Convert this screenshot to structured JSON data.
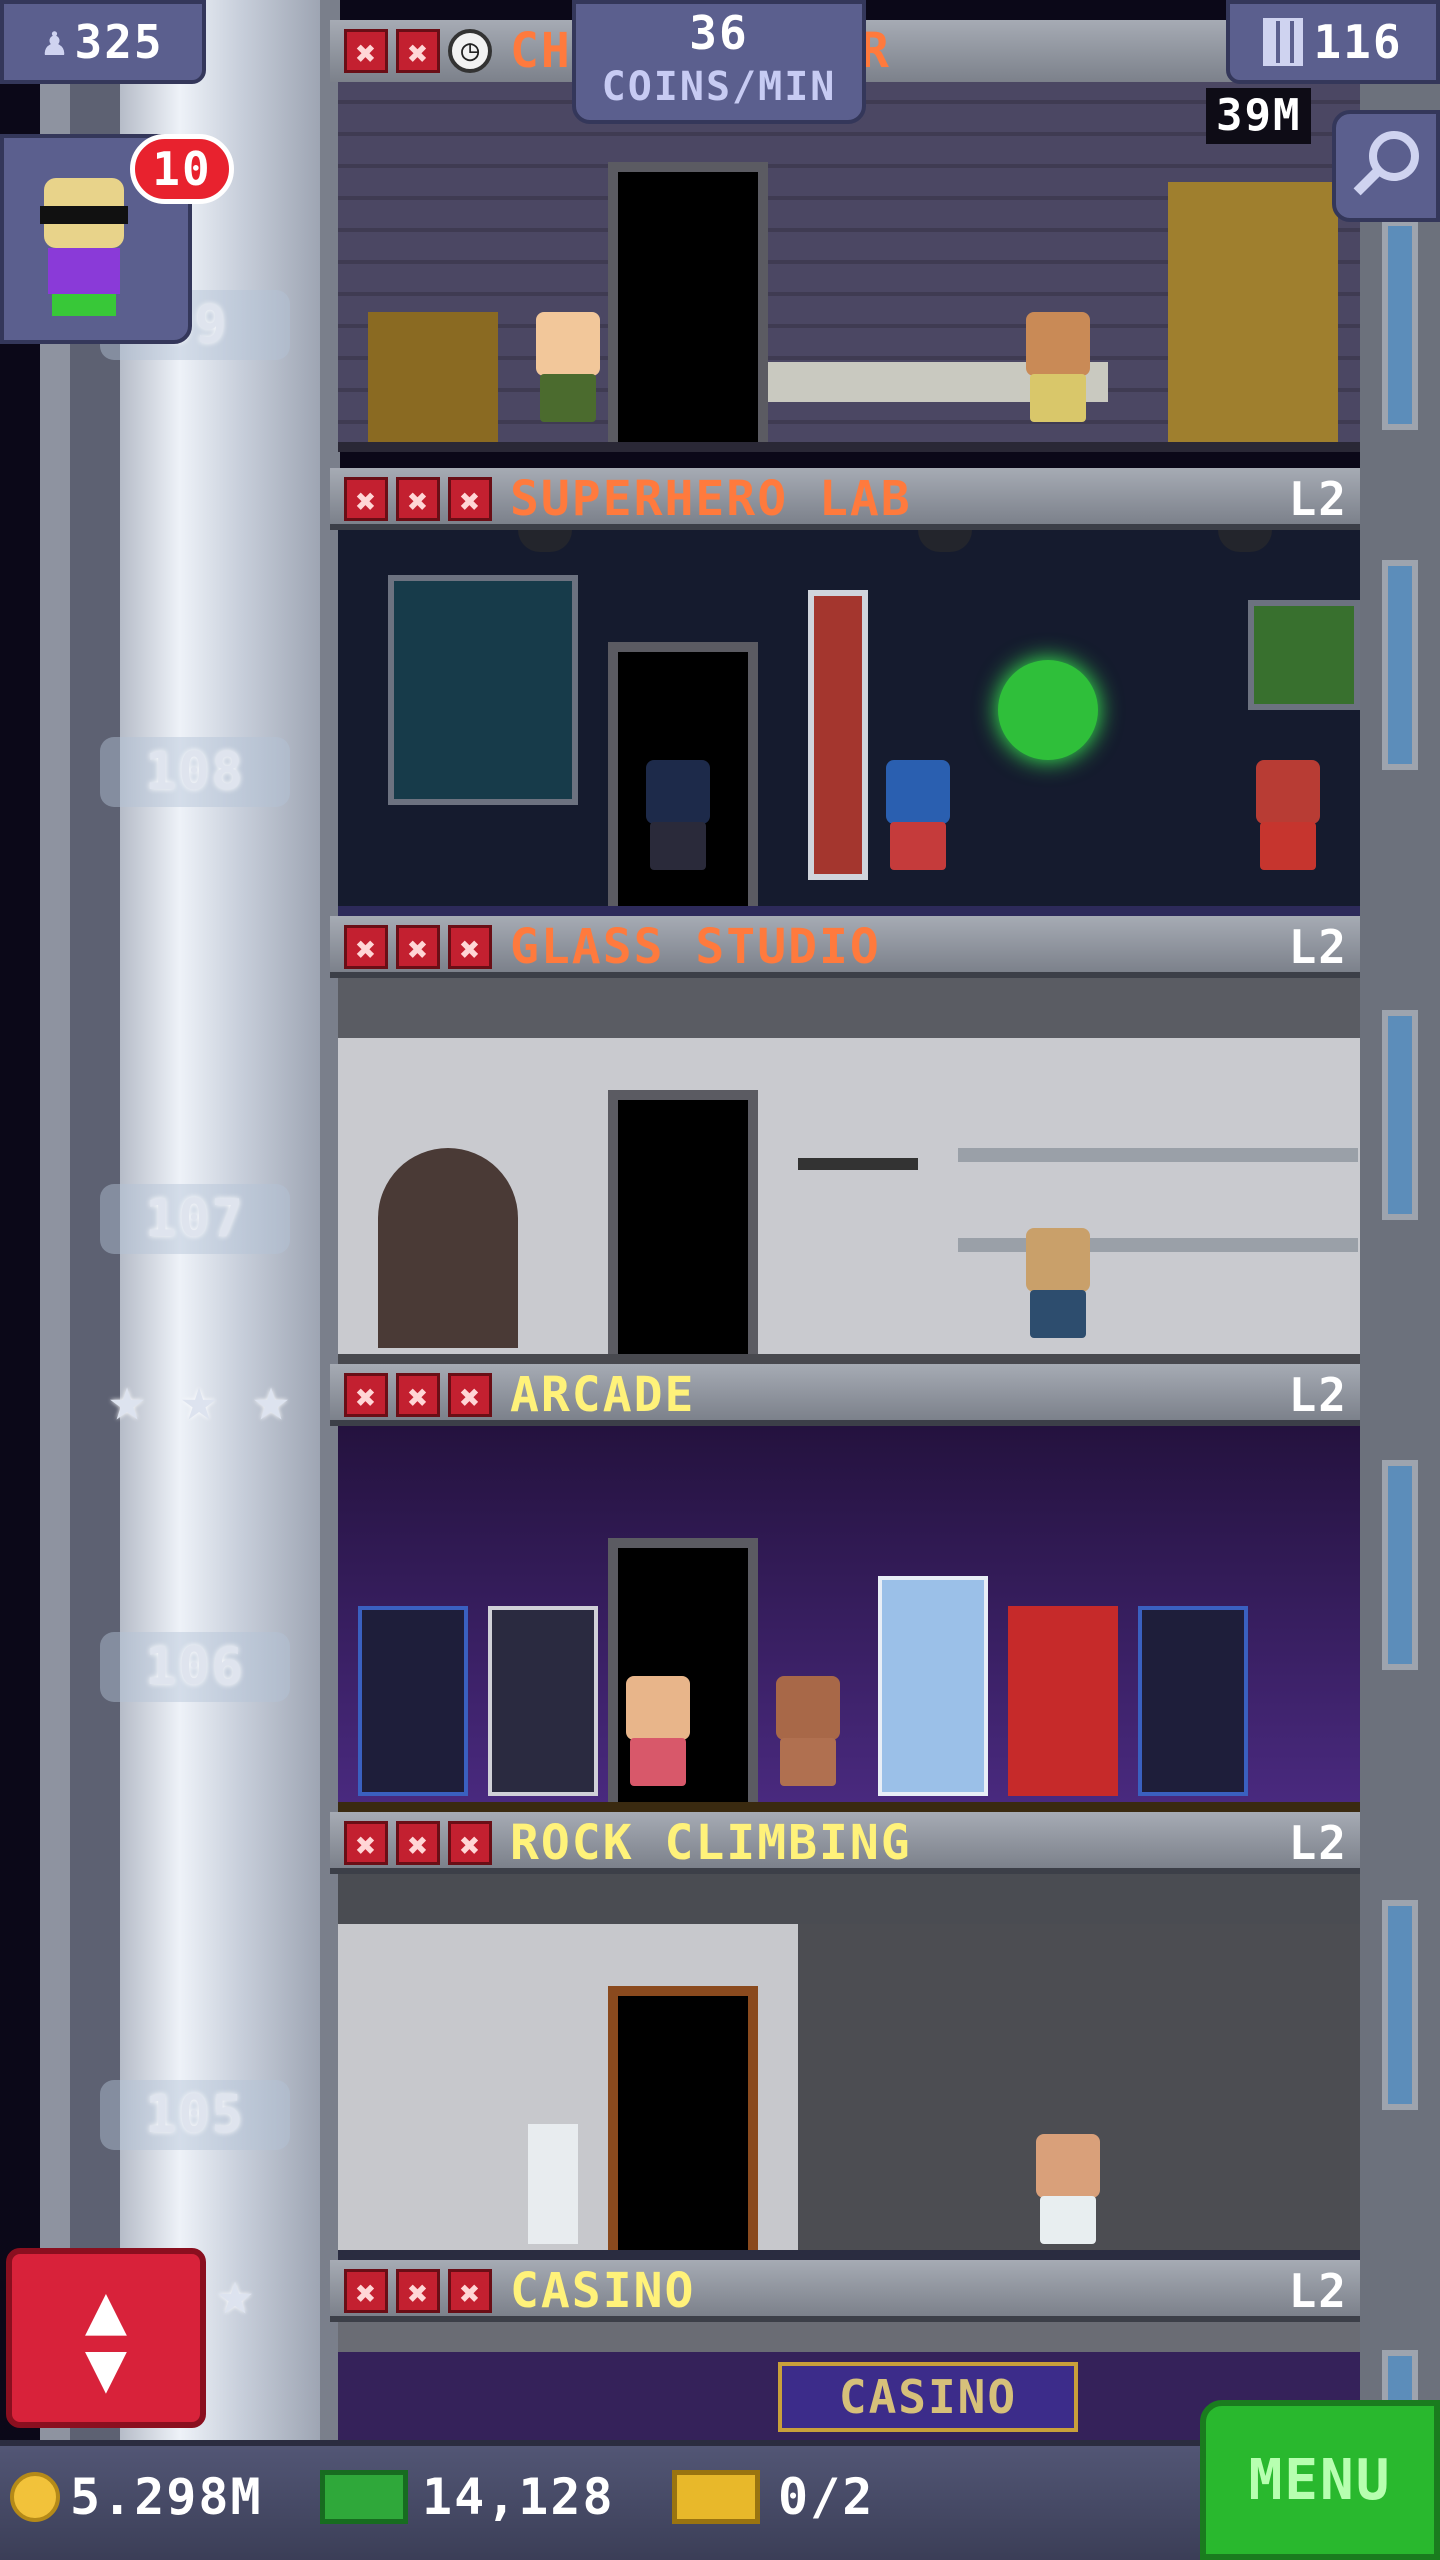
{
  "hud": {
    "population": "325",
    "coins_per_min_value": "36",
    "coins_per_min_label": "COINS/MIN",
    "floors_count": "116",
    "floor_stock": "39M",
    "notifications": "10"
  },
  "top_floor": {
    "name_visible": "CH",
    "name_tail": "R",
    "stocked": 2,
    "status": "restocking"
  },
  "floors": [
    {
      "number": "",
      "name": "SUPERHERO LAB",
      "level": "L2",
      "name_color": "#ff7a3d",
      "room_bg": "#141a2c"
    },
    {
      "number": "108",
      "name": "GLASS STUDIO",
      "level": "L2",
      "name_color": "#ff7a3d",
      "room_bg": "#cfd0d4"
    },
    {
      "number": "107",
      "name": "ARCADE",
      "level": "L2",
      "name_color": "#fff27a",
      "room_bg": "#2c1848"
    },
    {
      "number": "106",
      "name": "ROCK CLIMBING",
      "level": "L2",
      "name_color": "#fff27a",
      "room_bg": "#3e4048"
    },
    {
      "number": "105",
      "name": "CASINO",
      "level": "L2",
      "name_color": "#fff27a",
      "room_bg": "#35225a"
    }
  ],
  "casino_sign": "CASINO",
  "bottom": {
    "coins": "5.298M",
    "bux": "14,128",
    "vip": "0/2",
    "menu_label": "MENU"
  },
  "icons": [
    "person-icon",
    "building-icon",
    "magnifier-icon",
    "coin-icon",
    "bux-icon",
    "vip-ticket-icon",
    "elevator-arrows-icon",
    "star-icon",
    "stock-x-icon",
    "clock-icon"
  ],
  "colors": {
    "menu": "#29b82e",
    "elevator_button": "#d8223a",
    "hud_panel": "#5b5f8e"
  }
}
